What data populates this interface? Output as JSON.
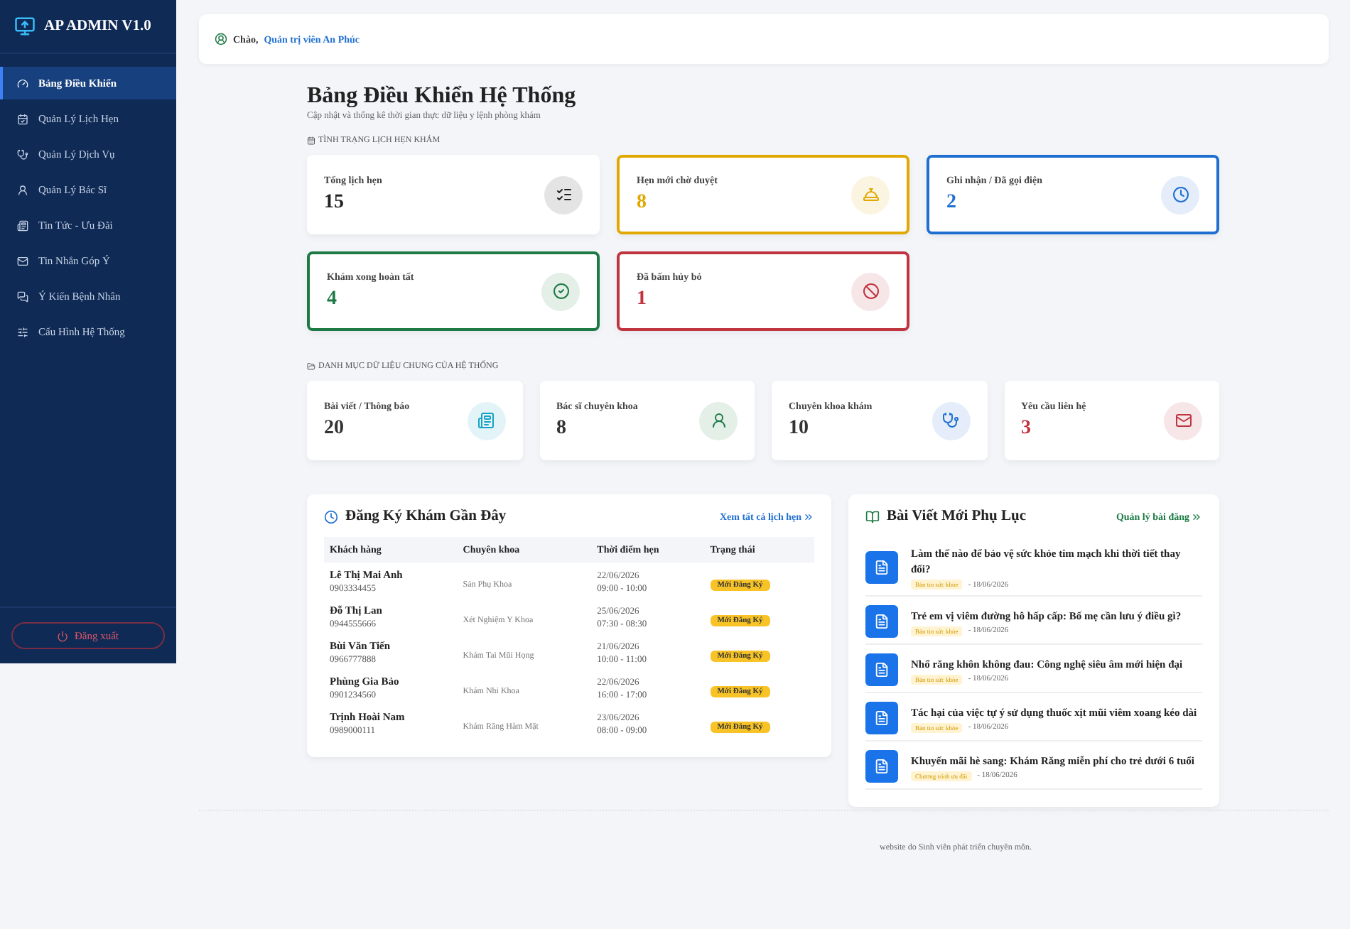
{
  "sidebar": {
    "brand": "AP ADMIN V1.0",
    "items": [
      {
        "label": "Bảng Điều Khiển",
        "selected": true
      },
      {
        "label": "Quản Lý Lịch Hẹn",
        "selected": false
      },
      {
        "label": "Quản Lý Dịch Vụ",
        "selected": false
      },
      {
        "label": "Quản Lý Bác Sĩ",
        "selected": false
      },
      {
        "label": "Tin Tức - Ưu Đãi",
        "selected": false
      },
      {
        "label": "Tin Nhắn Góp Ý",
        "selected": false
      },
      {
        "label": "Ý Kiến Bệnh Nhân",
        "selected": false
      },
      {
        "label": "Cấu Hình Hệ Thống",
        "selected": false
      }
    ],
    "logout": "Đăng xuất"
  },
  "topbar": {
    "greeting": "Chào,",
    "user": "Quản trị viên An Phúc"
  },
  "header": {
    "title": "Bảng Điều Khiển Hệ Thống",
    "subtitle": "Cập nhật và thống kê thời gian thực dữ liệu y lệnh phòng khám"
  },
  "status_section": {
    "heading": "TÌNH TRẠNG LỊCH HẸN KHÁM",
    "cards": [
      {
        "label": "Tổng lịch hẹn",
        "value": "15",
        "color": "#222222",
        "outlined": false
      },
      {
        "label": "Hẹn mới chờ duyệt",
        "value": "8",
        "color": "#e0a800",
        "outlined": true
      },
      {
        "label": "Ghi nhận / Đã gọi điện",
        "value": "2",
        "color": "#1f6fd1",
        "outlined": true
      },
      {
        "label": "Khám xong hoàn tất",
        "value": "4",
        "color": "#1d7a45",
        "outlined": true
      },
      {
        "label": "Đã bấm hủy bỏ",
        "value": "1",
        "color": "#c0343f",
        "outlined": true
      }
    ]
  },
  "catalog_section": {
    "heading": "DANH MỤC DỮ LIỆU CHUNG CỦA HỆ THỐNG",
    "cards": [
      {
        "label": "Bài viết / Thông báo",
        "value": "20",
        "color": "#17a2c8",
        "highlight": false
      },
      {
        "label": "Bác sĩ chuyên khoa",
        "value": "8",
        "color": "#1d7a45",
        "highlight": false
      },
      {
        "label": "Chuyên khoa khám",
        "value": "10",
        "color": "#1f6fd1",
        "highlight": false
      },
      {
        "label": "Yêu cầu liên hệ",
        "value": "3",
        "color": "#c0343f",
        "highlight": true
      }
    ]
  },
  "appointments": {
    "title": "Đăng Ký Khám Gần Đây",
    "link": "Xem tất cả lịch hẹn",
    "columns": [
      "Khách hàng",
      "Chuyên khoa",
      "Thời điểm hẹn",
      "Trạng thái"
    ],
    "rows": [
      {
        "name": "Lê Thị Mai Anh",
        "phone": "0903334455",
        "specialty": "Sản Phụ Khoa",
        "date": "22/06/2026",
        "time": "09:00 - 10:00",
        "status": "Mới Đăng Ký"
      },
      {
        "name": "Đỗ Thị Lan",
        "phone": "0944555666",
        "specialty": "Xét Nghiệm Y Khoa",
        "date": "25/06/2026",
        "time": "07:30 - 08:30",
        "status": "Mới Đăng Ký"
      },
      {
        "name": "Bùi Văn Tiến",
        "phone": "0966777888",
        "specialty": "Khám Tai Mũi Họng",
        "date": "21/06/2026",
        "time": "10:00 - 11:00",
        "status": "Mới Đăng Ký"
      },
      {
        "name": "Phùng Gia Bảo",
        "phone": "0901234560",
        "specialty": "Khám Nhi Khoa",
        "date": "22/06/2026",
        "time": "16:00 - 17:00",
        "status": "Mới Đăng Ký"
      },
      {
        "name": "Trịnh Hoài Nam",
        "phone": "0989000111",
        "specialty": "Khám Răng Hàm Mặt",
        "date": "23/06/2026",
        "time": "08:00 - 09:00",
        "status": "Mới Đăng Ký"
      }
    ]
  },
  "posts": {
    "title": "Bài Viết Mới Phụ Lục",
    "link": "Quản lý bài đăng",
    "items": [
      {
        "title": "Làm thế nào để bảo vệ sức khỏe tim mạch khi thời tiết thay đổi?",
        "category": "Bản tin sức khỏe",
        "date": "- 18/06/2026"
      },
      {
        "title": "Trẻ em vị viêm đường hô hấp cấp: Bố mẹ cần lưu ý điều gì?",
        "category": "Bản tin sức khỏe",
        "date": "- 18/06/2026"
      },
      {
        "title": "Nhổ răng khôn không đau: Công nghệ siêu âm mới hiện đại",
        "category": "Bản tin sức khỏe",
        "date": "- 18/06/2026"
      },
      {
        "title": "Tác hại của việc tự ý sử dụng thuốc xịt mũi viêm xoang kéo dài",
        "category": "Bản tin sức khỏe",
        "date": "- 18/06/2026"
      },
      {
        "title": "Khuyến mãi hè sang: Khám Răng miễn phí cho trẻ dưới 6 tuổi",
        "category": "Chương trình ưu đãi",
        "date": "- 18/06/2026"
      }
    ]
  },
  "footer": "website do Sinh viên phát triển chuyên môn."
}
